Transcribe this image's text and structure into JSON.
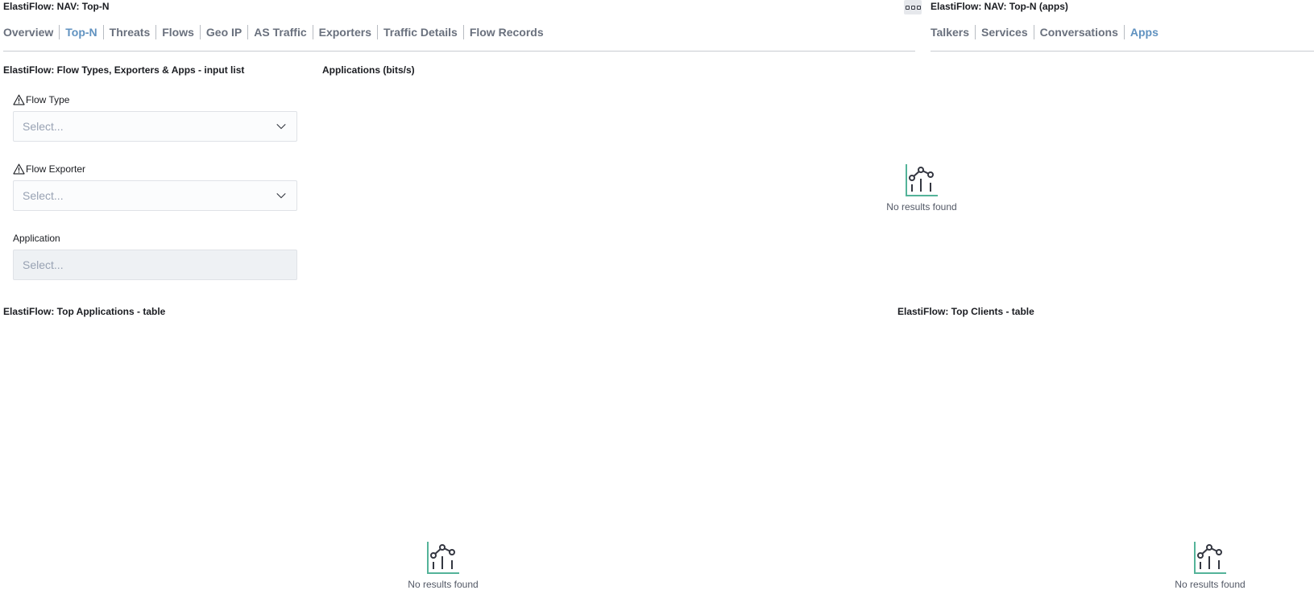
{
  "nav_main": {
    "title": "ElastiFlow: NAV: Top-N",
    "links": [
      "Overview",
      "Top-N",
      "Threats",
      "Flows",
      "Geo IP",
      "AS Traffic",
      "Exporters",
      "Traffic Details",
      "Flow Records"
    ],
    "active": "Top-N"
  },
  "nav_apps": {
    "title": "ElastiFlow: NAV: Top-N (apps)",
    "links": [
      "Talkers",
      "Services",
      "Conversations",
      "Apps"
    ],
    "active": "Apps"
  },
  "input_panel": {
    "title": "ElastiFlow: Flow Types, Exporters & Apps - input list",
    "controls": [
      {
        "label": "Flow Type",
        "placeholder": "Select...",
        "warning": true
      },
      {
        "label": "Flow Exporter",
        "placeholder": "Select...",
        "warning": true
      },
      {
        "label": "Application",
        "placeholder": "Select...",
        "warning": false
      }
    ]
  },
  "apps_chart": {
    "title": "Applications (bits/s)",
    "empty_message": "No results found"
  },
  "top_apps": {
    "title": "ElastiFlow: Top Applications - table",
    "empty_message": "No results found"
  },
  "top_clients": {
    "title": "ElastiFlow: Top Clients - table",
    "empty_message": "No results found"
  },
  "icons": {
    "warning": "warning-icon",
    "chevron": "chevron-down-icon",
    "empty": "chart-empty-icon",
    "menu": "options-menu-icon"
  },
  "colors": {
    "active_link": "#6092c0",
    "inactive_link": "#69707d",
    "empty_icon_axis": "#54b399"
  }
}
